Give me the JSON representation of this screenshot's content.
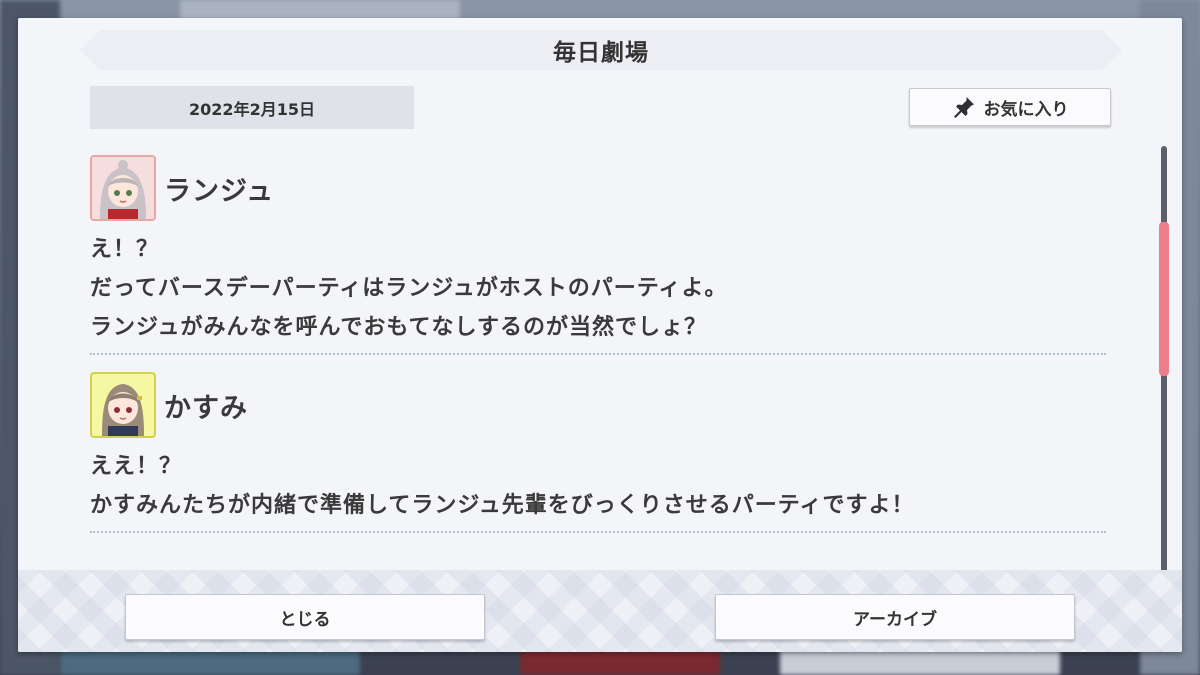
{
  "title": "毎日劇場",
  "date": "2022年2月15日",
  "favorite_button": {
    "label": "お気に入り",
    "icon": "pin-icon"
  },
  "entries": [
    {
      "speaker": "ランジュ",
      "avatar": "lanzhu-avatar",
      "lines": [
        "え！？",
        "だってバースデーパーティはランジュがホストのパーティよ。",
        "ランジュがみんなを呼んでおもてなしするのが当然でしょ？"
      ]
    },
    {
      "speaker": "かすみ",
      "avatar": "kasumi-avatar",
      "lines": [
        "ええ！？",
        "かすみんたちが内緒で準備してランジュ先輩をびっくりさせるパーティですよ！"
      ]
    }
  ],
  "buttons": {
    "close": "とじる",
    "archive": "アーカイブ"
  },
  "colors": {
    "scroll_thumb": "#ee7f8a",
    "panel": "#f4f5f9"
  }
}
